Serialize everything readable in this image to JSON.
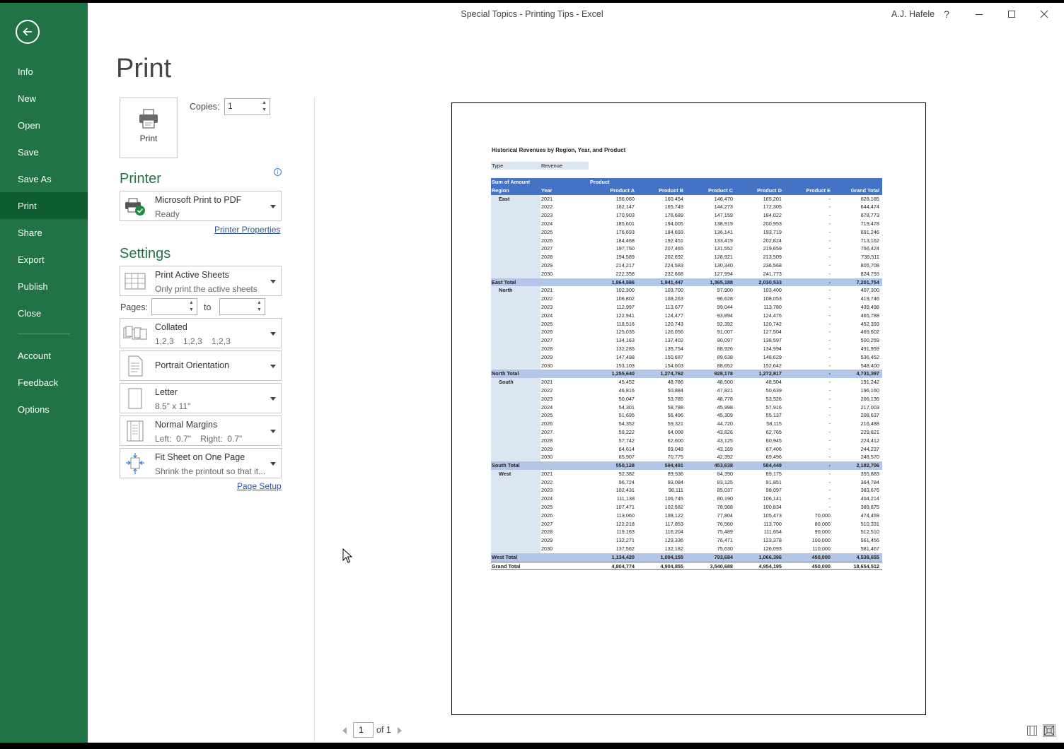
{
  "window": {
    "title": "Special Topics - Printing Tips  -  Excel",
    "user": "A.J. Hafele",
    "help": "?"
  },
  "sidebar": {
    "items": [
      {
        "label": "Info"
      },
      {
        "label": "New"
      },
      {
        "label": "Open"
      },
      {
        "label": "Save"
      },
      {
        "label": "Save As"
      },
      {
        "label": "Print",
        "active": true
      },
      {
        "label": "Share"
      },
      {
        "label": "Export"
      },
      {
        "label": "Publish"
      },
      {
        "label": "Close"
      },
      {
        "label": "Account"
      },
      {
        "label": "Feedback"
      },
      {
        "label": "Options"
      }
    ]
  },
  "print": {
    "heading": "Print",
    "button_label": "Print",
    "copies_label": "Copies:",
    "copies_value": "1"
  },
  "printer": {
    "heading": "Printer",
    "name": "Microsoft Print to PDF",
    "status": "Ready",
    "properties_link": "Printer Properties"
  },
  "settings": {
    "heading": "Settings",
    "what": {
      "main": "Print Active Sheets",
      "sub": "Only print the active sheets"
    },
    "pages_label": "Pages:",
    "pages_from": "",
    "pages_to_label": "to",
    "pages_to": "",
    "collation": {
      "main": "Collated",
      "sub": "1,2,3    1,2,3    1,2,3"
    },
    "orientation": {
      "main": "Portrait Orientation"
    },
    "paper": {
      "main": "Letter",
      "sub": "8.5\" x 11\""
    },
    "margins": {
      "main": "Normal Margins",
      "sub": "Left:  0.7\"    Right:  0.7\""
    },
    "scaling": {
      "main": "Fit Sheet on One Page",
      "sub": "Shrink the printout so that it..."
    },
    "page_setup_link": "Page Setup"
  },
  "preview": {
    "title": "Historical Revenues by Region, Year, and Product",
    "filter_label": "Type",
    "filter_value": "Revenue",
    "header1": {
      "c0": "Sum of Amount",
      "c2": "Product"
    },
    "header2": [
      "Region",
      "Year",
      "Product A",
      "Product B",
      "Product C",
      "Product D",
      "Product E",
      "Grand Total"
    ],
    "regions": [
      {
        "name": "East",
        "total_label": "East Total",
        "rows": [
          [
            "2021",
            "156,060",
            "160,454",
            "146,470",
            "165,201",
            "-",
            "628,185"
          ],
          [
            "2022",
            "162,147",
            "165,749",
            "144,273",
            "172,305",
            "-",
            "644,474"
          ],
          [
            "2023",
            "170,903",
            "176,689",
            "147,159",
            "184,022",
            "-",
            "678,773"
          ],
          [
            "2024",
            "185,601",
            "194,005",
            "138,919",
            "200,953",
            "-",
            "719,478"
          ],
          [
            "2025",
            "176,693",
            "184,693",
            "136,141",
            "193,719",
            "-",
            "691,246"
          ],
          [
            "2026",
            "184,468",
            "192,451",
            "133,419",
            "202,824",
            "-",
            "713,162"
          ],
          [
            "2027",
            "197,750",
            "207,465",
            "131,552",
            "219,659",
            "-",
            "756,424"
          ],
          [
            "2028",
            "194,589",
            "202,692",
            "128,921",
            "213,509",
            "-",
            "739,511"
          ],
          [
            "2029",
            "214,217",
            "224,583",
            "130,340",
            "236,568",
            "-",
            "805,708"
          ],
          [
            "2030",
            "222,358",
            "232,668",
            "127,994",
            "241,773",
            "-",
            "824,793"
          ]
        ],
        "total": [
          "",
          "1,864,586",
          "1,941,447",
          "1,365,188",
          "2,030,533",
          "-",
          "7,201,754"
        ]
      },
      {
        "name": "North",
        "total_label": "North Total",
        "rows": [
          [
            "2021",
            "102,300",
            "103,700",
            "97,900",
            "103,400",
            "-",
            "407,300"
          ],
          [
            "2022",
            "106,802",
            "108,263",
            "96,628",
            "108,053",
            "-",
            "419,746"
          ],
          [
            "2023",
            "112,997",
            "113,677",
            "99,044",
            "113,780",
            "-",
            "439,498"
          ],
          [
            "2024",
            "122,941",
            "124,477",
            "93,894",
            "124,476",
            "-",
            "465,788"
          ],
          [
            "2025",
            "118,516",
            "120,743",
            "92,392",
            "120,742",
            "-",
            "452,393"
          ],
          [
            "2026",
            "125,035",
            "126,056",
            "91,007",
            "127,504",
            "-",
            "469,602"
          ],
          [
            "2027",
            "134,163",
            "137,402",
            "90,097",
            "138,597",
            "-",
            "500,259"
          ],
          [
            "2028",
            "132,285",
            "135,754",
            "88,926",
            "134,994",
            "-",
            "491,959"
          ],
          [
            "2029",
            "147,498",
            "150,687",
            "89,638",
            "148,629",
            "-",
            "536,452"
          ],
          [
            "2030",
            "153,103",
            "154,003",
            "88,652",
            "152,642",
            "-",
            "548,400"
          ]
        ],
        "total": [
          "",
          "1,255,640",
          "1,274,762",
          "928,178",
          "1,272,817",
          "-",
          "4,731,397"
        ]
      },
      {
        "name": "South",
        "total_label": "South Total",
        "rows": [
          [
            "2021",
            "45,452",
            "48,786",
            "48,500",
            "48,504",
            "-",
            "191,242"
          ],
          [
            "2022",
            "46,816",
            "50,884",
            "47,821",
            "50,639",
            "-",
            "196,160"
          ],
          [
            "2023",
            "50,047",
            "53,785",
            "48,778",
            "53,526",
            "-",
            "206,136"
          ],
          [
            "2024",
            "54,301",
            "58,788",
            "45,998",
            "57,916",
            "-",
            "217,003"
          ],
          [
            "2025",
            "51,695",
            "56,496",
            "45,309",
            "55,137",
            "-",
            "208,637"
          ],
          [
            "2026",
            "54,352",
            "59,321",
            "44,720",
            "58,115",
            "-",
            "216,488"
          ],
          [
            "2027",
            "59,222",
            "64,008",
            "43,826",
            "62,765",
            "-",
            "229,821"
          ],
          [
            "2028",
            "57,742",
            "62,600",
            "43,125",
            "60,945",
            "-",
            "224,412"
          ],
          [
            "2029",
            "64,614",
            "69,048",
            "43,169",
            "67,406",
            "-",
            "244,237"
          ],
          [
            "2030",
            "65,907",
            "70,775",
            "42,392",
            "69,496",
            "-",
            "248,570"
          ]
        ],
        "total": [
          "",
          "550,128",
          "594,491",
          "453,638",
          "584,449",
          "-",
          "2,182,706"
        ]
      },
      {
        "name": "West",
        "total_label": "West Total",
        "rows": [
          [
            "2021",
            "92,382",
            "89,936",
            "84,390",
            "89,175",
            "-",
            "355,883"
          ],
          [
            "2022",
            "96,724",
            "93,084",
            "83,125",
            "91,851",
            "-",
            "364,784"
          ],
          [
            "2023",
            "102,431",
            "98,111",
            "85,037",
            "98,097",
            "-",
            "383,676"
          ],
          [
            "2024",
            "111,138",
            "106,745",
            "80,190",
            "106,141",
            "-",
            "404,214"
          ],
          [
            "2025",
            "107,471",
            "102,582",
            "78,988",
            "100,834",
            "-",
            "389,875"
          ],
          [
            "2026",
            "113,060",
            "108,122",
            "77,804",
            "105,473",
            "70,000",
            "474,459"
          ],
          [
            "2027",
            "122,218",
            "117,853",
            "76,560",
            "113,700",
            "80,000",
            "510,331"
          ],
          [
            "2028",
            "119,163",
            "116,204",
            "75,489",
            "111,654",
            "90,000",
            "512,510"
          ],
          [
            "2029",
            "132,271",
            "129,336",
            "76,471",
            "123,378",
            "100,000",
            "561,456"
          ],
          [
            "2030",
            "137,562",
            "132,182",
            "75,630",
            "126,093",
            "110,000",
            "581,467"
          ]
        ],
        "total": [
          "",
          "1,134,420",
          "1,094,155",
          "793,684",
          "1,066,396",
          "450,000",
          "4,538,655"
        ]
      }
    ],
    "grand_total_label": "Grand Total",
    "grand_total": [
      "",
      "4,804,774",
      "4,904,855",
      "3,540,688",
      "4,954,195",
      "450,000",
      "18,654,512"
    ]
  },
  "page_nav": {
    "current": "1",
    "of_label": "of 1"
  },
  "colors": {
    "sidebar": "#217346",
    "sidebar_active": "#0e5c2f",
    "accent": "#217346",
    "pivot_header": "#4472c4",
    "pivot_total": "#b4c6e7",
    "pivot_region": "#dce6f1"
  }
}
